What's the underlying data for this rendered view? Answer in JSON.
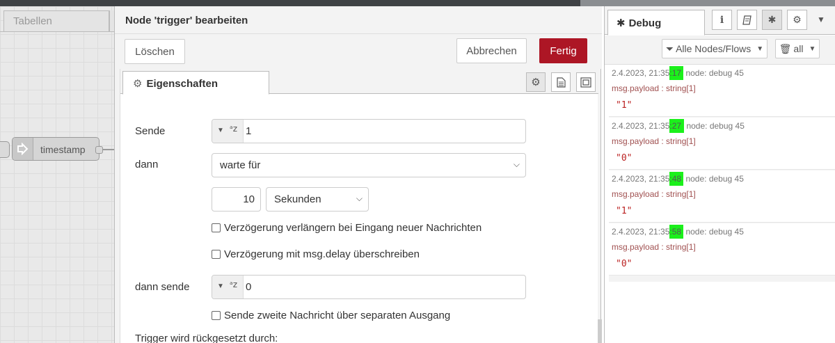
{
  "workspace": {
    "tab_label": "Tabellen",
    "node_label": "timestamp"
  },
  "editor": {
    "title": "Node 'trigger' bearbeiten",
    "delete_label": "Löschen",
    "cancel_label": "Abbrechen",
    "done_label": "Fertig",
    "tab_label": "Eigenschaften",
    "form": {
      "send_label": "Sende",
      "send_value": "1",
      "then_label": "dann",
      "then_option": "warte für",
      "duration_value": "10",
      "duration_unit": "Sekunden",
      "extend_label": "Verzögerung verlängern bei Eingang neuer Nachrichten",
      "override_label": "Verzögerung mit msg.delay überschreiben",
      "then_send_label": "dann sende",
      "then_send_value": "0",
      "second_output_label": "Sende zweite Nachricht über separaten Ausgang",
      "reset_label": "Trigger wird rückgesetzt durch:"
    }
  },
  "sidebar": {
    "tab_label": "Debug",
    "filter_label": "Alle Nodes/Flows",
    "clear_label": "all",
    "messages": [
      {
        "ts_prefix": "2.4.2023, 21:35",
        "ts_highlight": ":17",
        "node": "node: debug 45",
        "path": "msg.payload : string[1]",
        "payload": "\"1\""
      },
      {
        "ts_prefix": "2.4.2023, 21:35",
        "ts_highlight": ":27",
        "node": "node: debug 45",
        "path": "msg.payload : string[1]",
        "payload": "\"0\""
      },
      {
        "ts_prefix": "2.4.2023, 21:35",
        "ts_highlight": ":48",
        "node": "node: debug 45",
        "path": "msg.payload : string[1]",
        "payload": "\"1\""
      },
      {
        "ts_prefix": "2.4.2023, 21:35",
        "ts_highlight": ":58",
        "node": "node: debug 45",
        "path": "msg.payload : string[1]",
        "payload": "\"0\""
      }
    ]
  },
  "colors": {
    "done_button": "#ad1625",
    "timestamp_highlight": "#1bf01b"
  }
}
